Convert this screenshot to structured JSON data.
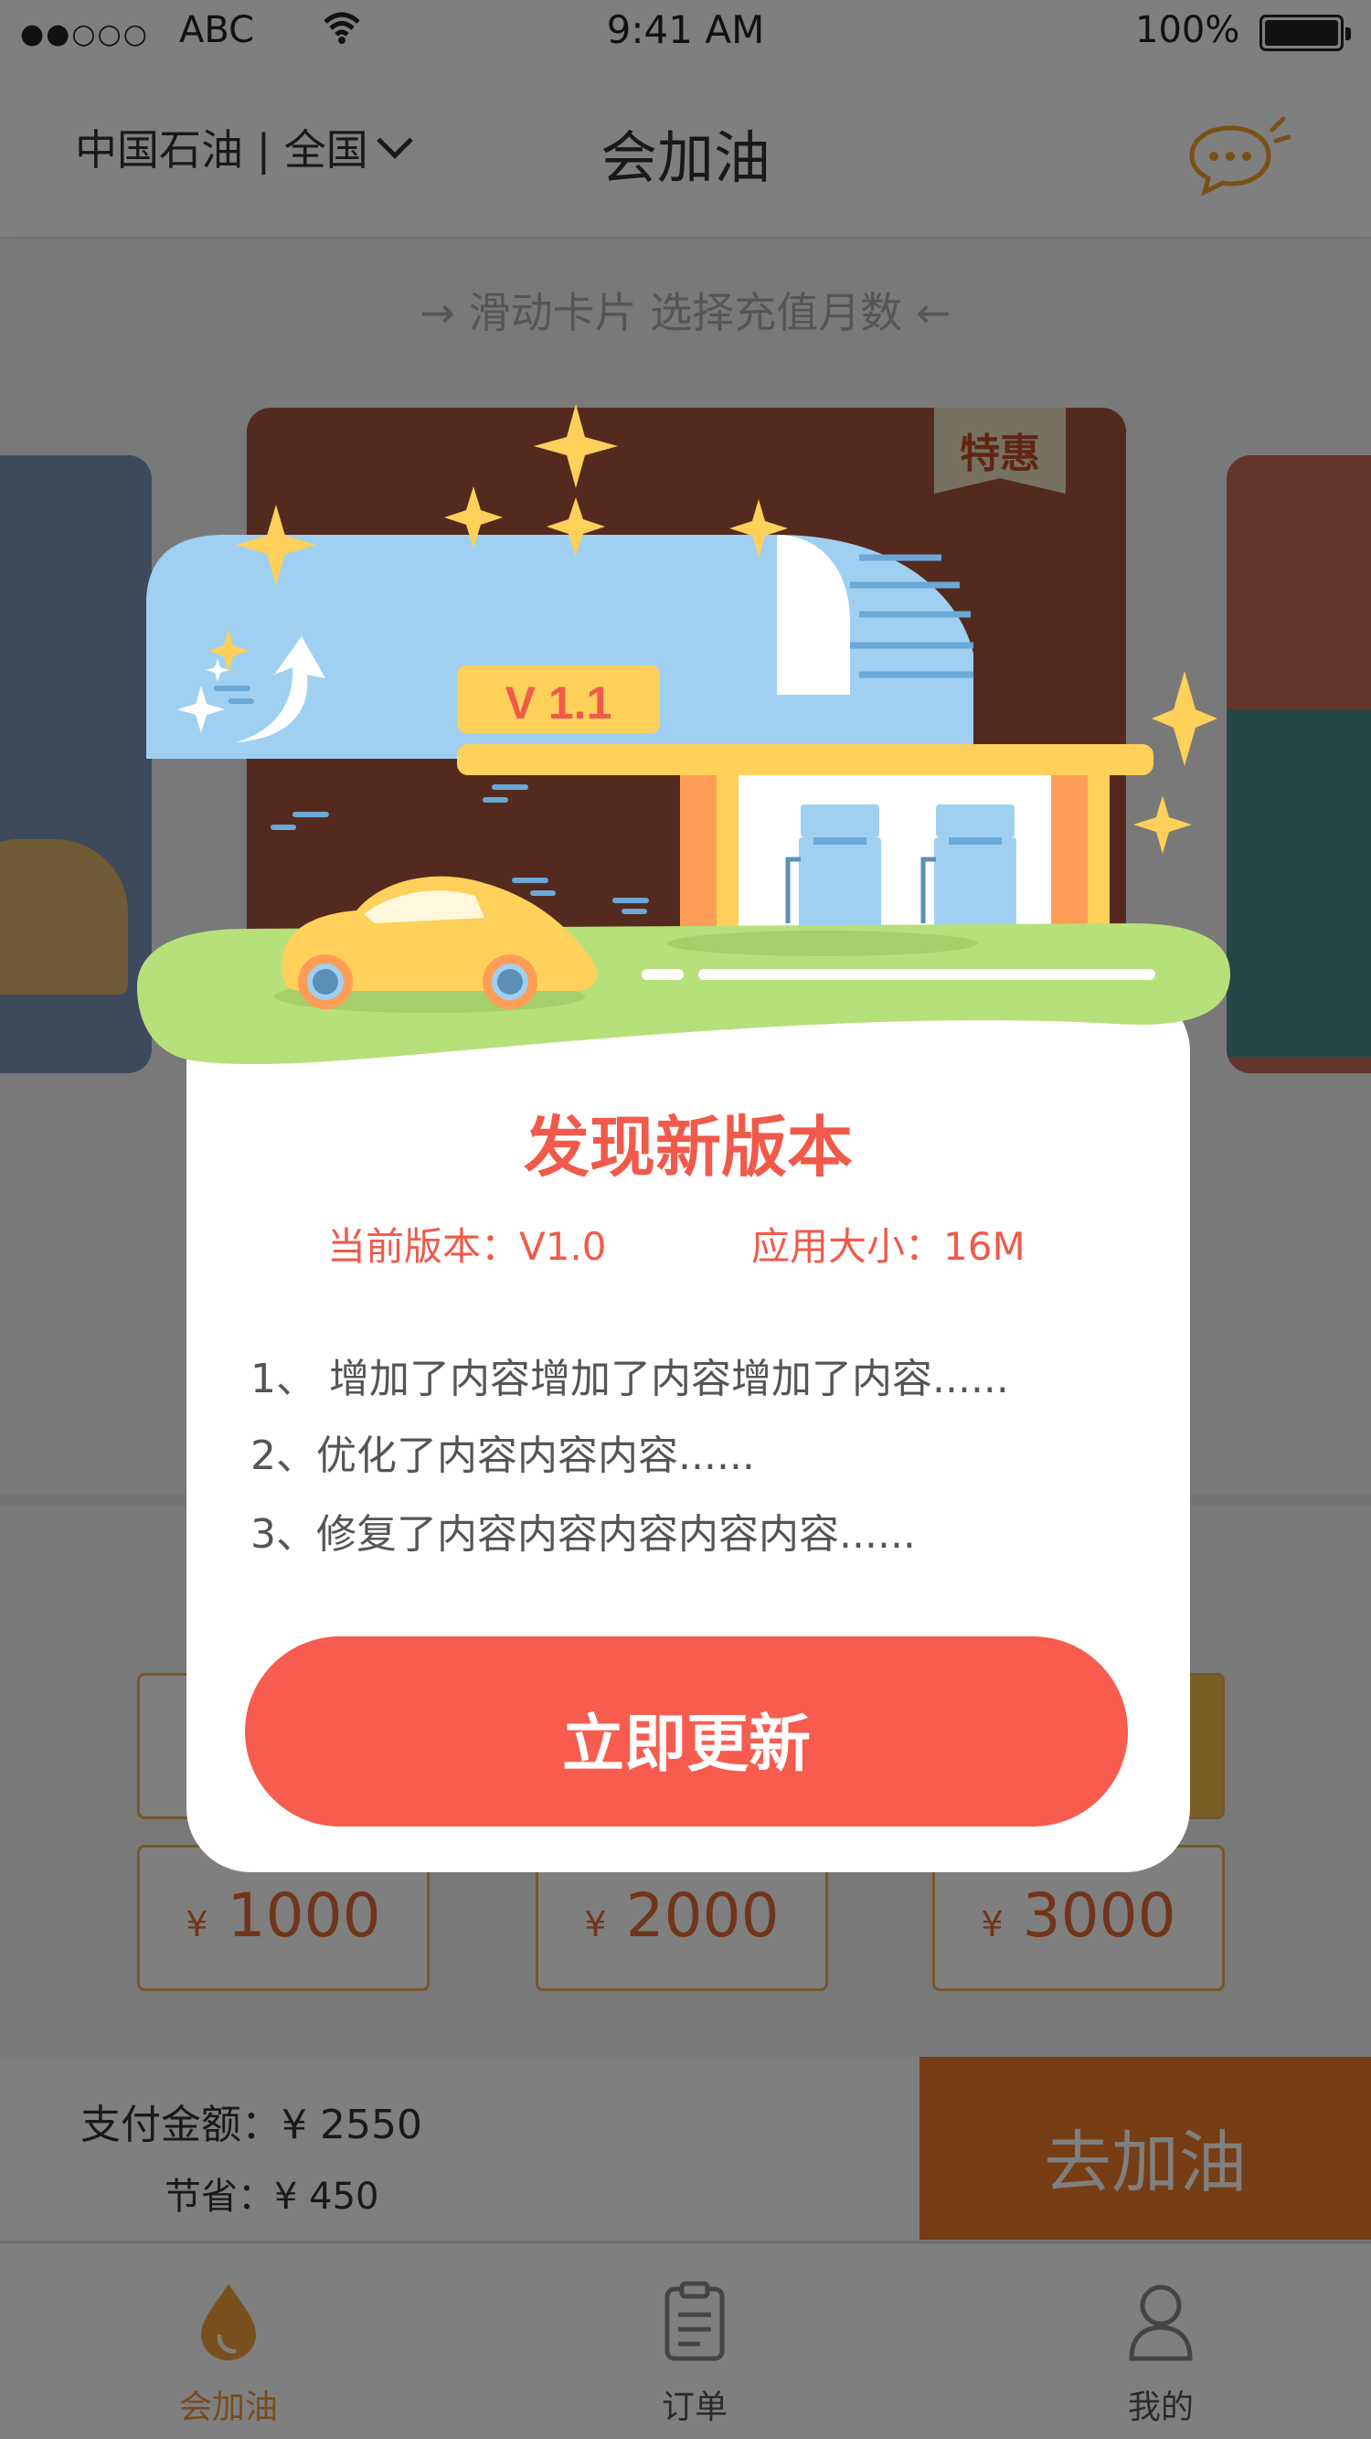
{
  "status_bar": {
    "signal": "●●○○○",
    "carrier": "ABC",
    "time": "9:41 AM",
    "battery_pct": "100%"
  },
  "nav": {
    "location": "中国石油 | 全国",
    "title": "会加油"
  },
  "hint": "→ 滑动卡片 选择充值月数 ←",
  "card_badge": "特惠",
  "amounts": [
    {
      "currency": "¥",
      "value": "1000"
    },
    {
      "currency": "¥",
      "value": "2000"
    },
    {
      "currency": "¥",
      "value": "3000"
    }
  ],
  "pay": {
    "amount_label": "支付金额：¥ 2550",
    "save_label": "节省：¥ 450",
    "go_button": "去加油"
  },
  "tabs": [
    {
      "label": "会加油",
      "icon": "drop-icon",
      "active": true
    },
    {
      "label": "订单",
      "icon": "clipboard-icon",
      "active": false
    },
    {
      "label": "我的",
      "icon": "user-icon",
      "active": false
    }
  ],
  "modal": {
    "version_badge": "V 1.1",
    "title": "发现新版本",
    "current_version": "当前版本：V1.0",
    "app_size": "应用大小：16M",
    "items": [
      "1、 增加了内容增加了内容增加了内容......",
      "2、优化了内容内容内容......",
      "3、修复了内容内容内容内容内容......"
    ],
    "update_button": "立即更新"
  },
  "colors": {
    "accent": "#f85c4f",
    "orange": "#ef7a2a",
    "sky": "#9fd0f2",
    "grass": "#b6e07a",
    "yellow": "#ffd05a"
  }
}
